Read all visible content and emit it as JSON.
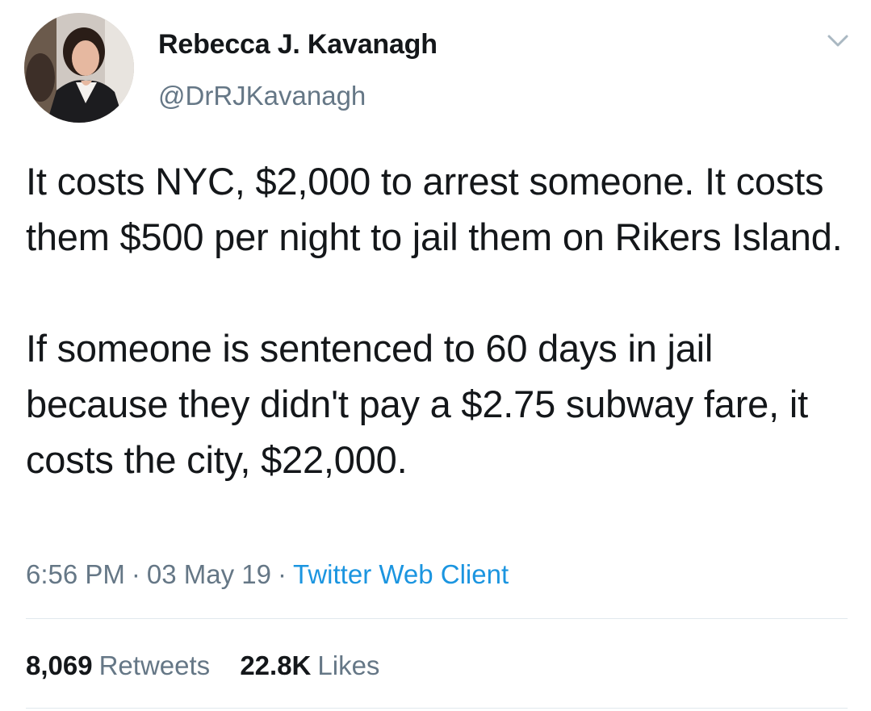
{
  "author": {
    "display_name": "Rebecca J. Kavanagh",
    "handle": "@DrRJKavanagh",
    "avatar_icon": "profile-photo"
  },
  "menu_icon": "chevron-down-icon",
  "tweet": {
    "text": "It costs NYC, $2,000 to arrest someone. It costs them $500 per night to jail them on Rikers Island.\n\nIf someone is sentenced to 60 days in jail because they didn't pay a $2.75 subway fare, it costs the city, $22,000."
  },
  "meta": {
    "time": "6:56 PM",
    "separator": "·",
    "date": "03 May 19",
    "client": "Twitter Web Client"
  },
  "stats": {
    "retweets_count": "8,069",
    "retweets_label": "Retweets",
    "likes_count": "22.8K",
    "likes_label": "Likes"
  },
  "colors": {
    "text": "#14171a",
    "secondary": "#657786",
    "link": "#1b95e0",
    "divider": "#e1e8ed"
  }
}
